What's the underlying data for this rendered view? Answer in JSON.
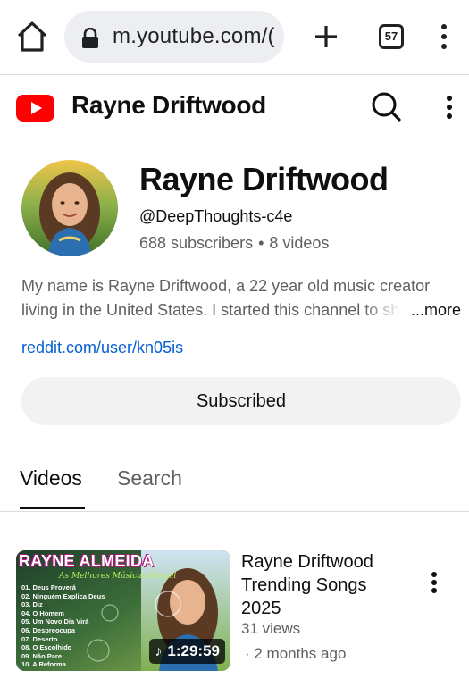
{
  "browser": {
    "url": "m.youtube.com/(",
    "tab_count": "57"
  },
  "header": {
    "title": "Rayne Driftwood"
  },
  "channel": {
    "name": "Rayne Driftwood",
    "handle": "@DeepThoughts-c4e",
    "subscribers": "688 subscribers",
    "separator": "•",
    "videos": "8 videos",
    "description_line1": "My name is Rayne Driftwood, a 22 year old music creator",
    "description_line2": "living in the United States. I started this channel to sha",
    "more_label": "...more",
    "link": "reddit.com/user/kn05is",
    "subscribe_label": "Subscribed"
  },
  "tabs": [
    {
      "label": "Videos",
      "active": true
    },
    {
      "label": "Search",
      "active": false
    }
  ],
  "videos": [
    {
      "title": "Rayne Driftwood Trending Songs 2025",
      "views": "31 views",
      "age": "· 2 months ago",
      "duration": "1:29:59",
      "thumbnail": {
        "title": "RAYNE ALMEIDA",
        "subtitle": "As Melhores Músicas Gospel",
        "tracks": [
          "01. Deus Proverá",
          "02. Ninguém Explica Deus",
          "03. Diz",
          "04. O Homem",
          "05. Um Novo Dia Virá",
          "06. Despreocupa",
          "07. Deserto",
          "08. O Escolhido",
          "09. Não Pare",
          "10. A Reforma"
        ]
      }
    }
  ],
  "colors": {
    "youtube_red": "#ff0000",
    "link_blue": "#065fd4",
    "secondary_text": "#606060"
  },
  "icons": {
    "home": "home-icon",
    "lock": "lock-icon",
    "new_tab": "plus-icon",
    "tabs": "tab-switcher-icon",
    "menu": "more-vert-icon",
    "logo": "youtube-logo-icon",
    "search": "search-icon",
    "music": "music-note-icon"
  }
}
